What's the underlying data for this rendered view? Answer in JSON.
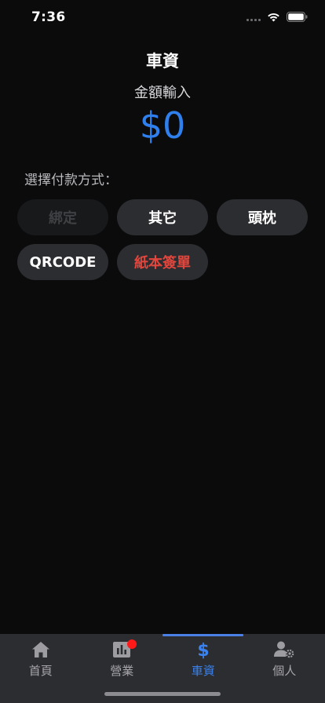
{
  "status_bar": {
    "time": "7:36"
  },
  "header": {
    "title": "車資",
    "amount_label": "金額輸入",
    "amount_value": "$0"
  },
  "payment": {
    "label": "選擇付款方式：",
    "options": [
      {
        "label": "綁定",
        "state": "disabled"
      },
      {
        "label": "其它",
        "state": "normal"
      },
      {
        "label": "頭枕",
        "state": "normal"
      },
      {
        "label": "QRCODE",
        "state": "normal"
      },
      {
        "label": "紙本簽單",
        "state": "highlight-red"
      }
    ]
  },
  "tab_bar": {
    "tabs": [
      {
        "label": "首頁",
        "icon": "home-icon"
      },
      {
        "label": "營業",
        "icon": "chart-icon",
        "badge": true
      },
      {
        "label": "車資",
        "icon": "dollar-icon",
        "active": true
      },
      {
        "label": "個人",
        "icon": "user-settings-icon"
      }
    ]
  },
  "colors": {
    "accent": "#2f80ed",
    "badge": "#ff1a1a",
    "warning_text": "#e2463c",
    "button_bg": "#2c2d30"
  }
}
